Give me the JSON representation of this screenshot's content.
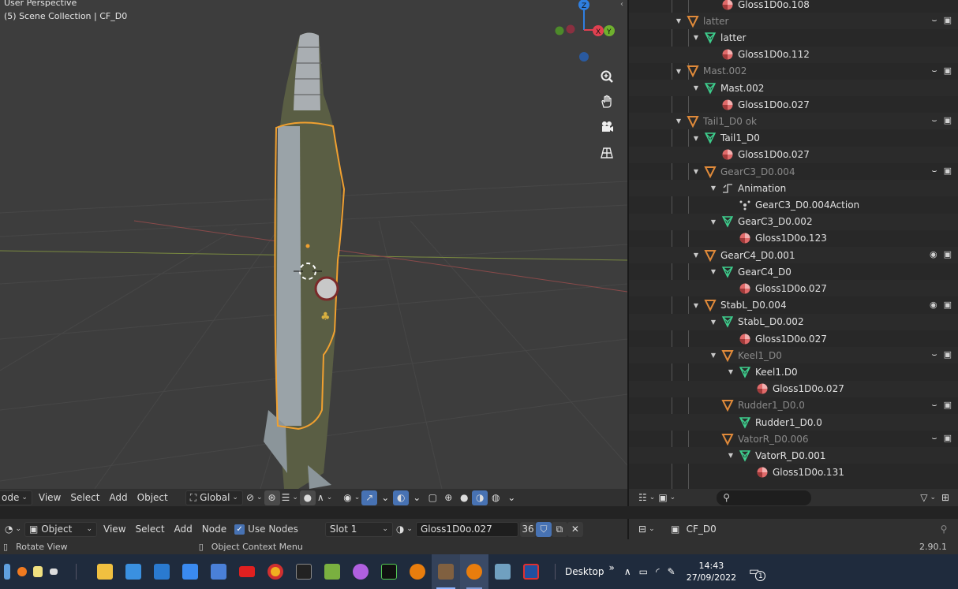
{
  "viewport": {
    "perspective_label": "User Perspective",
    "collection_label": "(5) Scene Collection | CF_D0",
    "gizmo_axes": {
      "z": "Z",
      "x": "X",
      "y": "Y"
    },
    "nav_buttons": [
      "zoom-icon",
      "hand-pan-icon",
      "camera-icon",
      "grid-perspective-icon"
    ]
  },
  "viewport_header": {
    "mode_label": "ode",
    "menus": [
      "View",
      "Select",
      "Add",
      "Object"
    ],
    "transform_orientation": "Global"
  },
  "outliner": {
    "rows": [
      {
        "label": "Gloss1D0o.108",
        "type": "material",
        "depth": 3,
        "dim": false
      },
      {
        "label": "latter",
        "type": "object",
        "depth": 1,
        "dim": true,
        "arrow": "down",
        "eye": false
      },
      {
        "label": "latter",
        "type": "mesh",
        "depth": 2,
        "dim": false,
        "arrow": "down"
      },
      {
        "label": "Gloss1D0o.112",
        "type": "material",
        "depth": 3,
        "dim": false
      },
      {
        "label": "Mast.002",
        "type": "object",
        "depth": 1,
        "dim": true,
        "arrow": "down",
        "eye": false
      },
      {
        "label": "Mast.002",
        "type": "mesh",
        "depth": 2,
        "dim": false,
        "arrow": "down"
      },
      {
        "label": "Gloss1D0o.027",
        "type": "material",
        "depth": 3,
        "dim": false
      },
      {
        "label": "Tail1_D0 ok",
        "type": "object",
        "depth": 1,
        "dim": true,
        "arrow": "down",
        "eye": false
      },
      {
        "label": "Tail1_D0",
        "type": "mesh",
        "depth": 2,
        "dim": false,
        "arrow": "down"
      },
      {
        "label": "Gloss1D0o.027",
        "type": "material",
        "depth": 3,
        "dim": false
      },
      {
        "label": "GearC3_D0.004",
        "type": "object",
        "depth": 2,
        "dim": true,
        "arrow": "down",
        "eye": false
      },
      {
        "label": "Animation",
        "type": "animation",
        "depth": 3,
        "dim": false,
        "arrow": "down"
      },
      {
        "label": "GearC3_D0.004Action",
        "type": "action",
        "depth": 4,
        "dim": false
      },
      {
        "label": "GearC3_D0.002",
        "type": "mesh",
        "depth": 3,
        "dim": false,
        "arrow": "down"
      },
      {
        "label": "Gloss1D0o.123",
        "type": "material",
        "depth": 4,
        "dim": false
      },
      {
        "label": "GearC4_D0.001",
        "type": "object",
        "depth": 2,
        "dim": false,
        "arrow": "down",
        "eye": true
      },
      {
        "label": "GearC4_D0",
        "type": "mesh",
        "depth": 3,
        "dim": false,
        "arrow": "down"
      },
      {
        "label": "Gloss1D0o.027",
        "type": "material",
        "depth": 4,
        "dim": false
      },
      {
        "label": "StabL_D0.004",
        "type": "object",
        "depth": 2,
        "dim": false,
        "arrow": "down",
        "eye": true
      },
      {
        "label": "StabL_D0.002",
        "type": "mesh",
        "depth": 3,
        "dim": false,
        "arrow": "down"
      },
      {
        "label": "Gloss1D0o.027",
        "type": "material",
        "depth": 4,
        "dim": false
      },
      {
        "label": "Keel1_D0",
        "type": "object",
        "depth": 3,
        "dim": true,
        "arrow": "down",
        "eye": false
      },
      {
        "label": "Keel1.D0",
        "type": "mesh",
        "depth": 4,
        "dim": false,
        "arrow": "down"
      },
      {
        "label": "Gloss1D0o.027",
        "type": "material",
        "depth": 5,
        "dim": false
      },
      {
        "label": "Rudder1_D0.0",
        "type": "object",
        "depth": 3,
        "dim": true,
        "arrow": "none",
        "eye": false
      },
      {
        "label": "Rudder1_D0.0",
        "type": "mesh",
        "depth": 4,
        "dim": false
      },
      {
        "label": "VatorR_D0.006",
        "type": "object",
        "depth": 3,
        "dim": true,
        "arrow": "none",
        "eye": false
      },
      {
        "label": "VatorR_D0.001",
        "type": "mesh",
        "depth": 4,
        "dim": false,
        "arrow": "down"
      },
      {
        "label": "Gloss1D0o.131",
        "type": "material",
        "depth": 5,
        "dim": false
      }
    ]
  },
  "shader_header": {
    "mode_label": "Object",
    "menus": [
      "View",
      "Select",
      "Add",
      "Node"
    ],
    "use_nodes_label": "Use Nodes",
    "use_nodes_checked": true,
    "slot_label": "Slot 1",
    "material_name": "Gloss1D0o.027",
    "user_count": "36"
  },
  "outliner_bottom": {
    "scene_label": "CF_D0"
  },
  "statusbar": {
    "left_hint": "Rotate View",
    "middle_hint": "Object Context Menu",
    "version": "2.90.1"
  },
  "taskbar": {
    "desktop_label": "Desktop",
    "time": "14:43",
    "date": "27/09/2022",
    "notification_count": "1"
  },
  "colors": {
    "selection_outline": "#f0a030",
    "object_icon": "#e08a3a",
    "mesh_icon": "#3ecf8e",
    "material_icon": "#e06a6a",
    "accent": "#4772b3"
  }
}
